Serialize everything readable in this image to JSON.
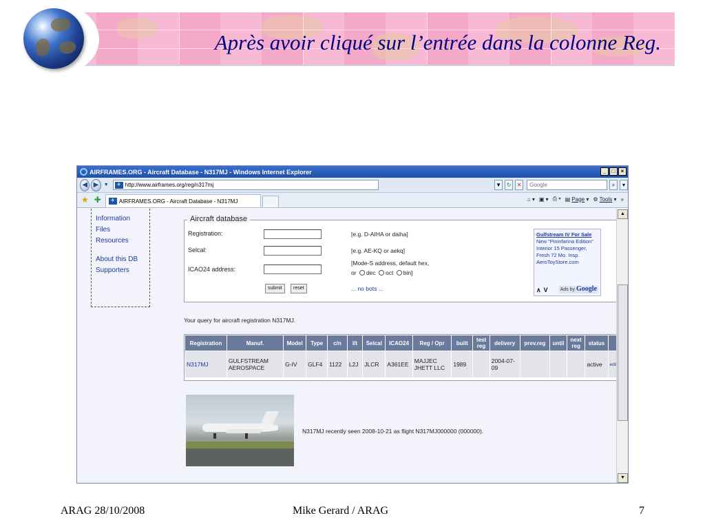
{
  "slide": {
    "title": "Après avoir cliqué sur l’entrée dans la colonne Reg.",
    "footer_left": "ARAG 28/10/2008",
    "footer_center": "Mike Gerard / ARAG",
    "footer_right": "7"
  },
  "browser": {
    "window_title": "AIRFRAMES.ORG - Aircraft Database - N317MJ - Windows Internet Explorer",
    "url": "http://www.airframes.org/reg/n317mj",
    "search_placeholder": "Google",
    "tab_label": "AIRFRAMES.ORG - Aircraft Database - N317MJ",
    "page_menu": "Page",
    "tools_menu": "Tools"
  },
  "sidebar": {
    "items": [
      "Information",
      "Files",
      "Resources",
      "About this DB",
      "Supporters"
    ]
  },
  "form": {
    "legend": "Aircraft database",
    "registration_label": "Registration:",
    "registration_hint": "[e.g. D-AIHA or daiha]",
    "selcal_label": "Selcal:",
    "selcal_hint": "[e.g. AE-KQ or aekq]",
    "icao_label": "ICAO24 address:",
    "icao_hint_line1": "[Mode-S address, default hex,",
    "icao_hint_or": "or",
    "radio_dec": "dec",
    "radio_oct": "oct",
    "radio_bin": "bin]",
    "submit_label": "submit",
    "reset_label": "reset",
    "nobots": "... no bots ..."
  },
  "ad": {
    "title": "Gulfstream IV For Sale",
    "body": "New \"Pininfarina Edition\" Interior 15 Passenger, Fresh 72 Mo. Insp.",
    "site": "AeroToyStore.com",
    "ads_by": "Ads by",
    "google": "Google"
  },
  "query_text": "Your query for aircraft registration N317MJ.",
  "table": {
    "headers": [
      "Registration",
      "Manuf.",
      "Model",
      "Type",
      "c/n",
      "l/t",
      "Selcal",
      "ICAO24",
      "Reg / Opr",
      "built",
      "test reg",
      "delivery",
      "prev.reg",
      "until",
      "next reg",
      "status",
      ""
    ],
    "row": {
      "registration": "N317MJ",
      "manuf": "GULFSTREAM AEROSPACE",
      "model": "G-IV",
      "type": "GLF4",
      "cn": "1122",
      "lt": "L2J",
      "selcal": "JLCR",
      "icao24": "A361EE",
      "reg_opr": "MAJJEC JHETT LLC",
      "built": "1989",
      "test_reg": "",
      "delivery": "2004-07-09",
      "prev_reg": "",
      "until": "",
      "next_reg": "",
      "status": "active",
      "edit": "edit"
    }
  },
  "seen_text": "N317MJ recently seen 2008-10-21 as flight N317MJ000000 (000000).",
  "colors": {
    "title_blue": "#000080",
    "table_header": "#6a7a9c",
    "link": "#1a3a9a"
  }
}
